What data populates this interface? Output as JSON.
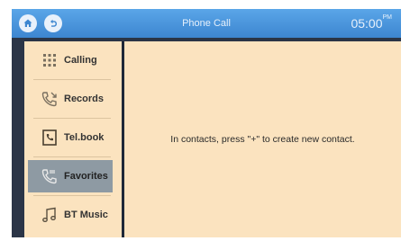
{
  "header": {
    "title": "Phone Call",
    "time": "05:00",
    "time_suffix": "PM"
  },
  "sidebar": {
    "items": [
      {
        "label": "Calling",
        "icon": "dialpad-icon",
        "active": false
      },
      {
        "label": "Records",
        "icon": "call-log-icon",
        "active": false
      },
      {
        "label": "Tel.book",
        "icon": "phonebook-icon",
        "active": false
      },
      {
        "label": "Favorites",
        "icon": "favorites-phone-icon",
        "active": true
      },
      {
        "label": "BT Music",
        "icon": "music-note-icon",
        "active": false
      }
    ]
  },
  "main": {
    "message": "In contacts, press \"+\" to create new contact."
  },
  "colors": {
    "topbar": "#4a96dc",
    "panel": "#fbe3bf",
    "active_item": "#8e9aa3",
    "frame": "#2a3446"
  }
}
